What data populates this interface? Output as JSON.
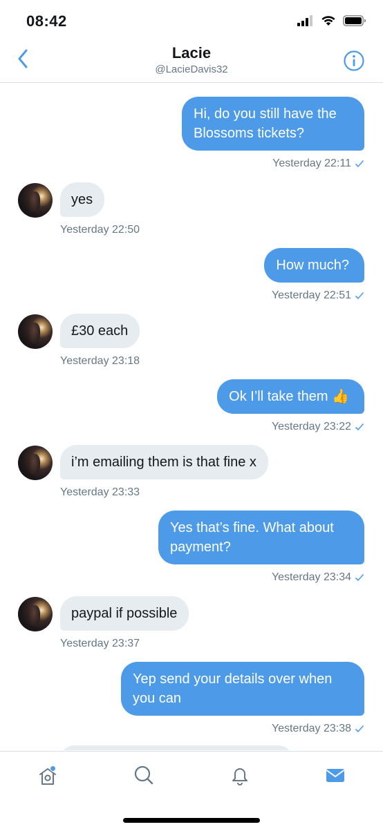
{
  "status_bar": {
    "time": "08:42",
    "icons": [
      "signal-icon",
      "wifi-icon",
      "battery-icon"
    ]
  },
  "header": {
    "name": "Lacie",
    "handle": "@LacieDavis32",
    "back_icon": "chevron-left-icon",
    "info_icon": "info-icon"
  },
  "colors": {
    "accent": "#4d9be8",
    "incoming_bubble": "#e6ecf0",
    "meta_text": "#657786"
  },
  "messages": [
    {
      "direction": "out",
      "text": "Hi, do you still have the Blossoms tickets?",
      "time": "Yesterday 22:11",
      "read": true
    },
    {
      "direction": "in",
      "text": "yes",
      "time": "Yesterday 22:50"
    },
    {
      "direction": "out",
      "text": "How much?",
      "time": "Yesterday 22:51",
      "read": true
    },
    {
      "direction": "in",
      "text": "£30 each",
      "time": "Yesterday 23:18"
    },
    {
      "direction": "out",
      "text": "Ok I’ll take them 👍",
      "time": "Yesterday 23:22",
      "read": true
    },
    {
      "direction": "in",
      "text": "i’m emailing them is that fine x",
      "time": "Yesterday 23:33"
    },
    {
      "direction": "out",
      "text": "Yes that’s fine. What about payment?",
      "time": "Yesterday 23:34",
      "read": true
    },
    {
      "direction": "in",
      "text": "paypal if possible",
      "time": "Yesterday 23:37"
    },
    {
      "direction": "out",
      "text": "Yep send your details over when you can",
      "time": "Yesterday 23:38",
      "read": true
    }
  ],
  "tab_bar": {
    "tabs": [
      {
        "name": "home",
        "icon": "home-icon",
        "has_notification_dot": true
      },
      {
        "name": "search",
        "icon": "search-icon"
      },
      {
        "name": "notifications",
        "icon": "bell-icon"
      },
      {
        "name": "messages",
        "icon": "mail-icon",
        "active": true
      }
    ]
  }
}
